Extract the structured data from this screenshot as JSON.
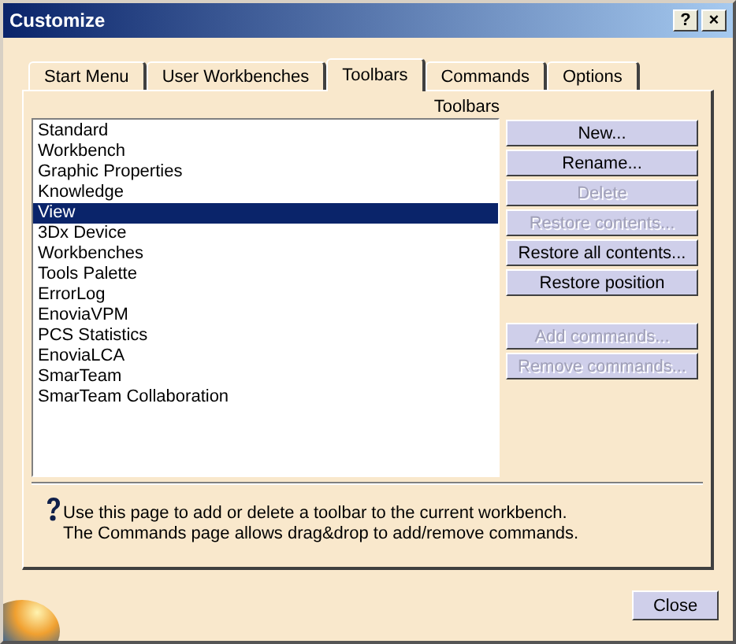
{
  "window": {
    "title": "Customize",
    "title_buttons": [
      "?",
      "×"
    ]
  },
  "tabs": [
    {
      "label": "Start Menu",
      "selected": false
    },
    {
      "label": "User Workbenches",
      "selected": false
    },
    {
      "label": "Toolbars",
      "selected": true
    },
    {
      "label": "Commands",
      "selected": false
    },
    {
      "label": "Options",
      "selected": false
    }
  ],
  "toolbars": {
    "heading": "Toolbars",
    "items": [
      {
        "label": "Standard",
        "selected": false
      },
      {
        "label": "Workbench",
        "selected": false
      },
      {
        "label": "Graphic Properties",
        "selected": false
      },
      {
        "label": "Knowledge",
        "selected": false
      },
      {
        "label": "View",
        "selected": true
      },
      {
        "label": "3Dx Device",
        "selected": false
      },
      {
        "label": "Workbenches",
        "selected": false
      },
      {
        "label": "Tools Palette",
        "selected": false
      },
      {
        "label": "ErrorLog",
        "selected": false
      },
      {
        "label": "EnoviaVPM",
        "selected": false
      },
      {
        "label": "PCS Statistics",
        "selected": false
      },
      {
        "label": "EnoviaLCA",
        "selected": false
      },
      {
        "label": "SmarTeam",
        "selected": false
      },
      {
        "label": "SmarTeam Collaboration",
        "selected": false
      }
    ]
  },
  "toolbar_buttons": [
    {
      "label": "New...",
      "disabled": false
    },
    {
      "label": "Rename...",
      "disabled": false
    },
    {
      "label": "Delete",
      "disabled": true
    },
    {
      "label": "Restore contents...",
      "disabled": true
    },
    {
      "label": "Restore all contents...",
      "disabled": false
    },
    {
      "label": "Restore position",
      "disabled": false
    }
  ],
  "command_buttons": [
    {
      "label": "Add commands...",
      "disabled": true
    },
    {
      "label": "Remove commands...",
      "disabled": true
    }
  ],
  "help": [
    "Use this page to add or delete a toolbar to the current workbench.",
    "The Commands page allows drag&drop to add/remove commands."
  ],
  "footer_buttons": [
    "Close"
  ]
}
